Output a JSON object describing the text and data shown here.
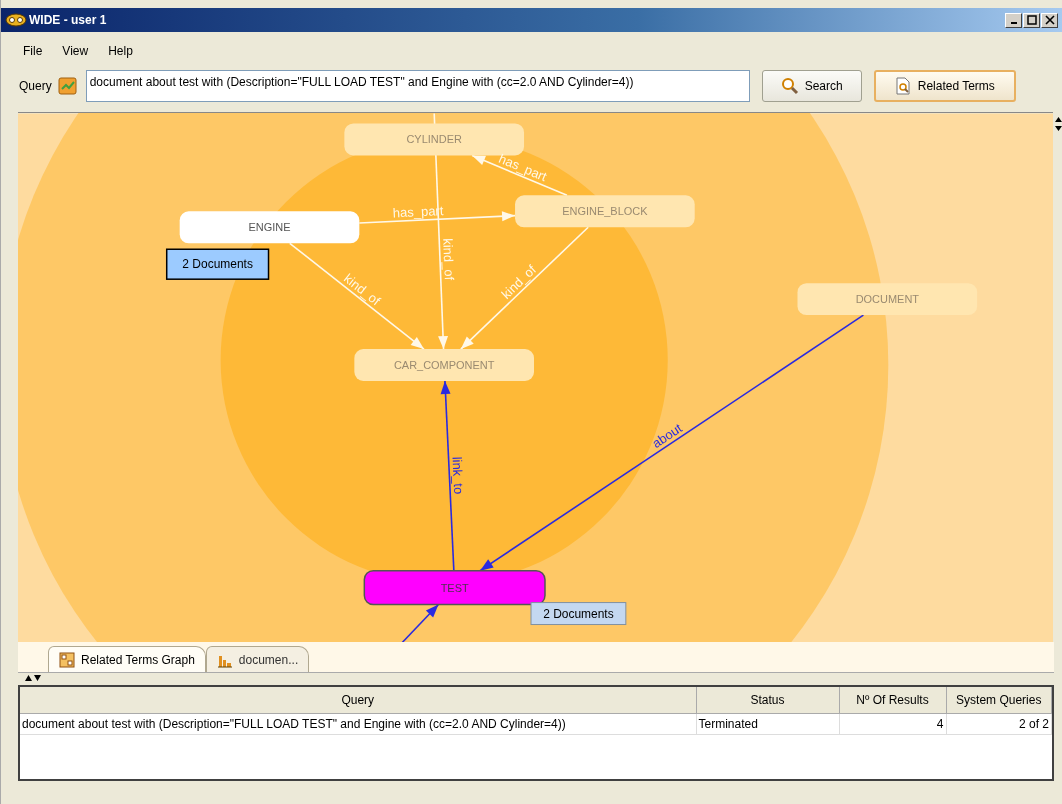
{
  "window": {
    "title": "WIDE - user 1"
  },
  "menu": [
    {
      "label": "File"
    },
    {
      "label": "View"
    },
    {
      "label": "Help"
    }
  ],
  "query_bar": {
    "label": "Query",
    "value": "document about test with (Description=\"FULL LOAD TEST\" and Engine with (cc=2.0 AND Cylinder=4))",
    "buttons": [
      {
        "label": "Search",
        "kind": "search"
      },
      {
        "label": "Related Terms",
        "kind": "related"
      }
    ]
  },
  "graph": {
    "nodes": [
      {
        "label": "CYLINDER",
        "kind": "faded"
      },
      {
        "label": "ENGINE",
        "kind": "plain"
      },
      {
        "label": "ENGINE_BLOCK",
        "kind": "faded"
      },
      {
        "label": "DOCUMENT",
        "kind": "faded"
      },
      {
        "label": "CAR_COMPONENT",
        "kind": "faded"
      },
      {
        "label": "TEST",
        "kind": "focus"
      }
    ],
    "edges": [
      {
        "label": "has_part",
        "kind": "plain"
      },
      {
        "label": "has_part",
        "kind": "plain"
      },
      {
        "label": "kind_of",
        "kind": "plain"
      },
      {
        "label": "kind_of",
        "kind": "plain"
      },
      {
        "label": "kind_of",
        "kind": "plain"
      },
      {
        "label": "link_to",
        "kind": "highlighted"
      },
      {
        "label": "about",
        "kind": "highlighted"
      },
      {
        "kind": "highlighted"
      }
    ],
    "tags": [
      {
        "label": "2 Documents",
        "kind": "boxed"
      },
      {
        "label": "2 Documents",
        "kind": "soft"
      }
    ]
  },
  "tabs": [
    {
      "label": "Related Terms Graph",
      "selected": true
    },
    {
      "label": "documen...",
      "selected": false
    }
  ],
  "table": {
    "columns": [
      "Query",
      "Status",
      "Nº Of Results",
      "System Queries"
    ],
    "rows": [
      [
        "document about test with (Description=\"FULL LOAD TEST\" and Engine with (cc=2.0 AND Cylinder=4))",
        "Terminated",
        "4",
        "2 of 2"
      ]
    ]
  }
}
